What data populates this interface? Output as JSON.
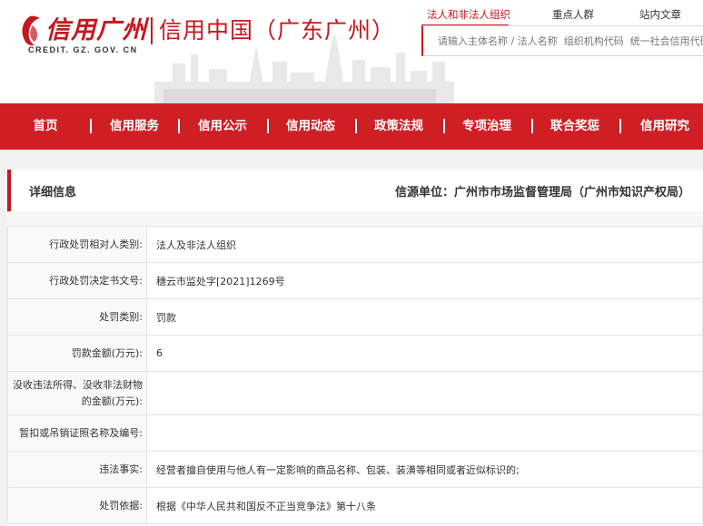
{
  "header": {
    "logo_name": "信用广州",
    "logo_subtitle": "信用中国（广东广州）",
    "logo_url": "CREDIT. GZ. GOV. CN",
    "search_tabs": [
      "法人和非法人组织",
      "重点人群",
      "站内文章"
    ],
    "search_placeholder": "请输入主体名称 / 法人名称  组织机构代码  统一社会信用代码等",
    "accent_color": "#c8161d"
  },
  "nav": {
    "items": [
      "首页",
      "信用服务",
      "信用公示",
      "信用动态",
      "政策法规",
      "专项治理",
      "联合奖惩",
      "信用研究"
    ],
    "bg_color": "#cf1f25"
  },
  "panel": {
    "title": "详细信息",
    "source_label": "信源单位：",
    "source_value": "广州市市场监督管理局（广州市知识产权局）"
  },
  "details": [
    {
      "label": "行政处罚相对人类别:",
      "value": "法人及非法人组织"
    },
    {
      "label": "行政处罚决定书文号:",
      "value": "穗云市监处字[2021]1269号"
    },
    {
      "label": "处罚类别:",
      "value": "罚款"
    },
    {
      "label": "罚款金额(万元):",
      "value": "6"
    },
    {
      "label": "没收违法所得、没收非法财物的金额(万元):",
      "value": ""
    },
    {
      "label": "暂扣或吊销证照名称及编号:",
      "value": ""
    },
    {
      "label": "违法事实:",
      "value": "经营者擅自使用与他人有一定影响的商品名称、包装、装潢等相同或者近似标识的;"
    },
    {
      "label": "处罚依据:",
      "value": "根据《中华人民共和国反不正当竞争法》第十八条"
    }
  ]
}
